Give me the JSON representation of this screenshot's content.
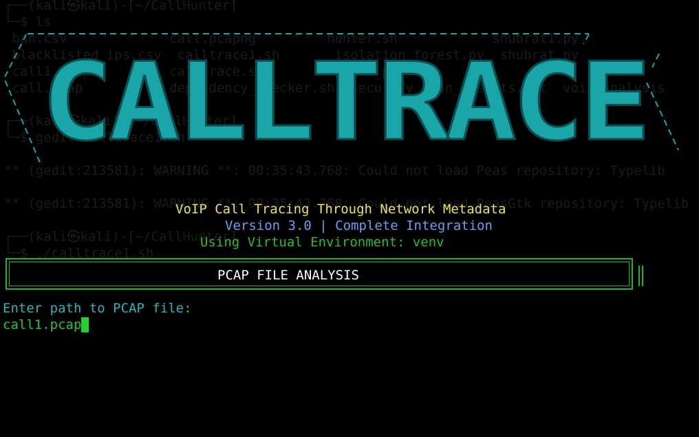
{
  "ghost_terminal": {
    "prompt1": "┌──(kali㉿kali)-[~/CallHunter]",
    "cmd1": "└─$ ls",
    "row1": " ban.csv             call.pcapng         hunter.sh            shubrat1.py",
    "row2": " blacklisted_ips.csv  calltrace1.sh       isolation_forest.py  shubrat.py",
    "row3": " call1.pcap          calltrace.sh         parse_pcap.py",
    "row4": " call.pcap           dependency_checker.sh  security_scan_results.txt  voip_analysis",
    "prompt2": "┌──(kali㉿kali)-[~/CallHunter]",
    "cmd2": "└─$ gedit calltrace1.sh",
    "warn1": "** (gedit:213581): WARNING **: 00:35:43.768: Could not load Peas repository: Typelib",
    "warn2": "** (gedit:213581): WARNING **: 00:35:43.768: Could not load PeasGtk repository: Typelib",
    "prompt3": "┌──(kali㉿kali)-[~/CallHunter]",
    "cmd3": "└─$ ./calltrace1.sh"
  },
  "banner": {
    "logo_text": "CALLTRACE",
    "colors": {
      "fill": "#1aa5a8",
      "shadow": "#1aa5a8",
      "frame": "#1aa5a8"
    }
  },
  "header": {
    "subtitle": "VoIP Call Tracing Through Network Metadata",
    "version_text": "Version 3.0 | Complete Integration",
    "venv_text": "Using Virtual Environment: venv"
  },
  "colors": {
    "subtitle": "#ede15a",
    "version": "#6c9ff0",
    "venv": "#2cb934",
    "box_border": "#17b82c",
    "prompt": "#2db3b8",
    "input": "#26c43a",
    "cursor": "#23d12d"
  },
  "section": {
    "title": "PCAP FILE ANALYSIS"
  },
  "input": {
    "prompt_label": "Enter path to PCAP file:",
    "value": "call1.pcap"
  }
}
